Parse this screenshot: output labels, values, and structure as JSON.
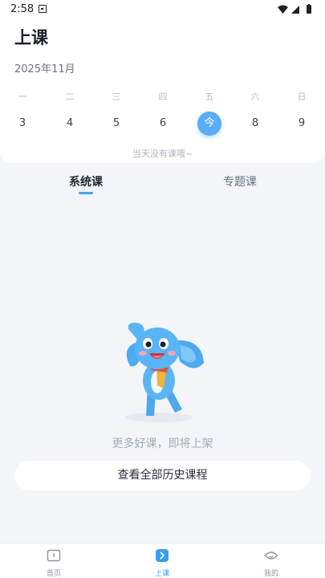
{
  "status_bar": {
    "time": "2:58"
  },
  "header": {
    "title": "上课",
    "month": "2025年11月"
  },
  "calendar": {
    "weekdays": [
      "一",
      "二",
      "三",
      "四",
      "五",
      "六",
      "日"
    ],
    "days": [
      "3",
      "4",
      "5",
      "6",
      "今",
      "8",
      "9"
    ],
    "today_index": 4,
    "empty_message": "当天没有课哦~"
  },
  "tabs": [
    {
      "label": "系统课",
      "active": true
    },
    {
      "label": "专题课",
      "active": false
    }
  ],
  "empty_state": {
    "message": "更多好课，即将上架",
    "button_label": "查看全部历史课程"
  },
  "bottom_nav": [
    {
      "label": "首页",
      "icon": "book-icon",
      "active": false
    },
    {
      "label": "上课",
      "icon": "play-icon",
      "active": true
    },
    {
      "label": "我的",
      "icon": "profile-icon",
      "active": false
    }
  ],
  "colors": {
    "accent": "#46a3f5",
    "background": "#f3f5f8",
    "card": "#ffffff"
  }
}
